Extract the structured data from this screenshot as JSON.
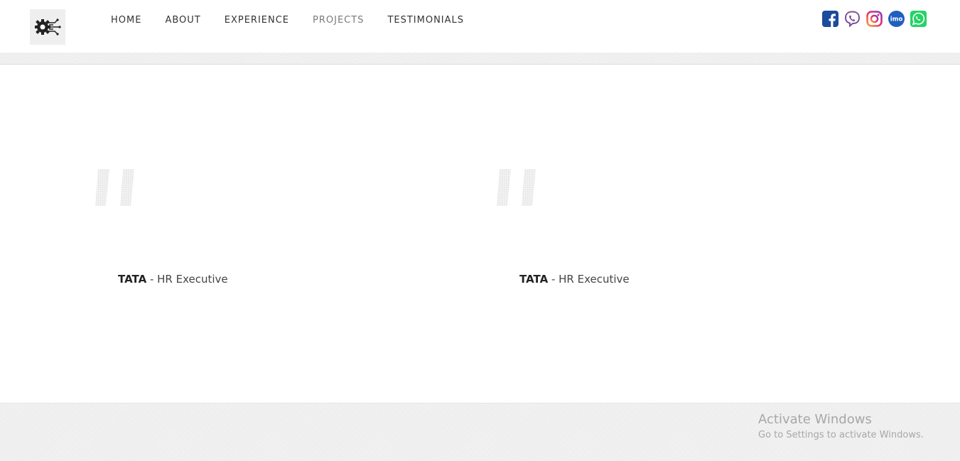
{
  "nav": {
    "items": [
      {
        "label": "HOME"
      },
      {
        "label": "ABOUT"
      },
      {
        "label": "EXPERIENCE"
      },
      {
        "label": "PROJECTS"
      },
      {
        "label": "TESTIMONIALS"
      }
    ]
  },
  "social": {
    "icons": [
      "facebook-icon",
      "viber-icon",
      "instagram-icon",
      "imo-icon",
      "whatsapp-icon"
    ],
    "imo_text": "imo",
    "colors": {
      "facebook": "#1b4b9b",
      "viber": "#7b519d",
      "instagram": "#d6249f",
      "imo": "#1f5fc1",
      "whatsapp": "#25d366"
    }
  },
  "testimonials": [
    {
      "company": "TATA",
      "separator": " - ",
      "role": "HR Executive"
    },
    {
      "company": "TATA",
      "separator": " - ",
      "role": "HR Executive"
    }
  ],
  "watermark": {
    "title": "Activate Windows",
    "subtitle": "Go to Settings to activate Windows."
  }
}
